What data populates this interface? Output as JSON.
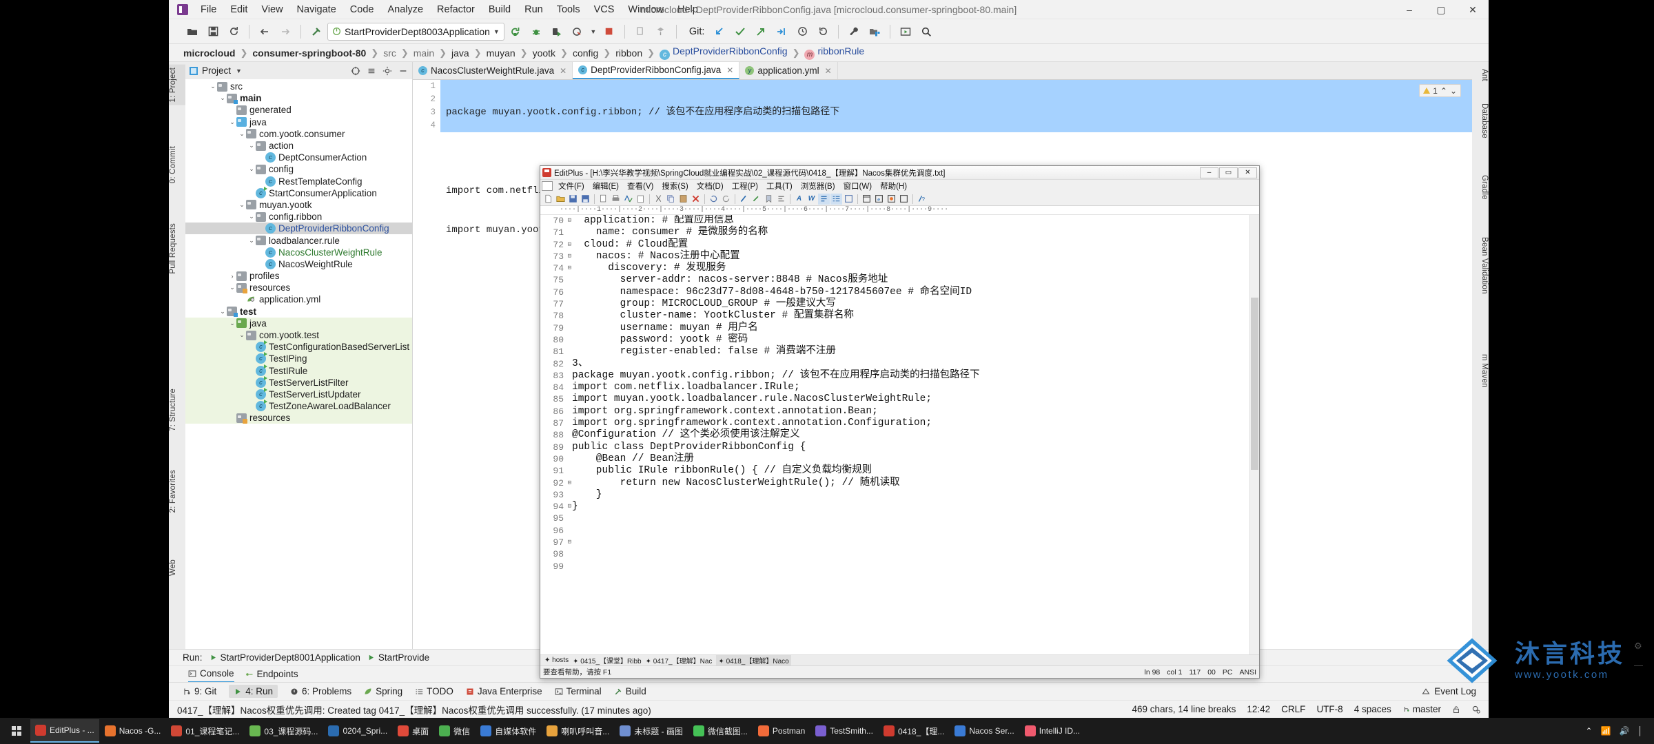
{
  "window": {
    "title": "microcloud - DeptProviderRibbonConfig.java [microcloud.consumer-springboot-80.main]",
    "minimize": "–",
    "maximize": "▢",
    "close": "✕"
  },
  "menubar": {
    "items": [
      "File",
      "Edit",
      "View",
      "Navigate",
      "Code",
      "Analyze",
      "Refactor",
      "Build",
      "Run",
      "Tools",
      "VCS",
      "Window",
      "Help"
    ]
  },
  "toolbar": {
    "run_config": "StartProviderDept8003Application",
    "git_label": "Git:",
    "icons": [
      "open-folder-icon",
      "save-icon",
      "sync-icon",
      "back-arrow-icon",
      "forward-arrow-icon",
      "build-hammer-icon",
      "run-icon",
      "debug-icon",
      "run-with-coverage-icon",
      "profile-icon",
      "stop-icon",
      "device-manager-icon",
      "sdk-manager-icon",
      "git-pull-icon",
      "git-commit-check-icon",
      "git-push-icon",
      "git-update-icon",
      "history-icon",
      "rollback-icon",
      "wrench-icon",
      "project-structure-icon",
      "presentation-icon",
      "search-everywhere-icon"
    ]
  },
  "breadcrumb": {
    "items": [
      {
        "label": "microcloud",
        "style": "bold"
      },
      {
        "label": "consumer-springboot-80",
        "style": "bold"
      },
      {
        "label": "src",
        "style": "dim"
      },
      {
        "label": "main",
        "style": "dim"
      },
      {
        "label": "java",
        "style": "normal"
      },
      {
        "label": "muyan",
        "style": "normal"
      },
      {
        "label": "yootk",
        "style": "normal"
      },
      {
        "label": "config",
        "style": "normal"
      },
      {
        "label": "ribbon",
        "style": "normal"
      },
      {
        "label": "DeptProviderRibbonConfig",
        "style": "class"
      },
      {
        "label": "ribbonRule",
        "style": "method"
      }
    ]
  },
  "left_rail": [
    {
      "label": "1: Project",
      "selected": true
    },
    {
      "label": "0: Commit",
      "selected": false
    },
    {
      "label": "Pull Requests",
      "selected": false
    },
    {
      "label": "7: Structure",
      "selected": false
    },
    {
      "label": "2: Favorites",
      "selected": false
    },
    {
      "label": "Web",
      "selected": false
    }
  ],
  "right_rail": [
    {
      "label": "Ant"
    },
    {
      "label": "Database"
    },
    {
      "label": "Gradle"
    },
    {
      "label": "Bean Validation"
    },
    {
      "label": "m Maven"
    }
  ],
  "project_panel": {
    "title": "Project",
    "tree": [
      {
        "indent": 2,
        "arrow": "v",
        "icon": "folder-gray",
        "label": "src",
        "style": "normal"
      },
      {
        "indent": 3,
        "arrow": "v",
        "icon": "folder-gray-src",
        "label": "main",
        "style": "bold"
      },
      {
        "indent": 4,
        "arrow": "",
        "icon": "folder-generated",
        "label": "generated",
        "style": "normal"
      },
      {
        "indent": 4,
        "arrow": "v",
        "icon": "folder-blue",
        "label": "java",
        "style": "normal"
      },
      {
        "indent": 5,
        "arrow": "v",
        "icon": "folder-pkg",
        "label": "com.yootk.consumer",
        "style": "normal"
      },
      {
        "indent": 6,
        "arrow": "v",
        "icon": "folder-pkg",
        "label": "action",
        "style": "normal"
      },
      {
        "indent": 7,
        "arrow": "",
        "icon": "class",
        "label": "DeptConsumerAction",
        "style": "normal"
      },
      {
        "indent": 6,
        "arrow": "v",
        "icon": "folder-pkg",
        "label": "config",
        "style": "normal"
      },
      {
        "indent": 7,
        "arrow": "",
        "icon": "class",
        "label": "RestTemplateConfig",
        "style": "normal"
      },
      {
        "indent": 6,
        "arrow": "",
        "icon": "class-run",
        "label": "StartConsumerApplication",
        "style": "normal"
      },
      {
        "indent": 5,
        "arrow": "v",
        "icon": "folder-pkg",
        "label": "muyan.yootk",
        "style": "normal"
      },
      {
        "indent": 6,
        "arrow": "v",
        "icon": "folder-pkg",
        "label": "config.ribbon",
        "style": "normal"
      },
      {
        "indent": 7,
        "arrow": "",
        "icon": "class",
        "label": "DeptProviderRibbonConfig",
        "style": "blue",
        "selected": true
      },
      {
        "indent": 6,
        "arrow": "v",
        "icon": "folder-pkg",
        "label": "loadbalancer.rule",
        "style": "normal"
      },
      {
        "indent": 7,
        "arrow": "",
        "icon": "class",
        "label": "NacosClusterWeightRule",
        "style": "green"
      },
      {
        "indent": 7,
        "arrow": "",
        "icon": "class",
        "label": "NacosWeightRule",
        "style": "normal"
      },
      {
        "indent": 4,
        "arrow": ">",
        "icon": "folder-gray",
        "label": "profiles",
        "style": "normal"
      },
      {
        "indent": 4,
        "arrow": "v",
        "icon": "folder-res",
        "label": "resources",
        "style": "normal"
      },
      {
        "indent": 5,
        "arrow": "",
        "icon": "yml",
        "label": "application.yml",
        "style": "normal"
      },
      {
        "indent": 3,
        "arrow": "v",
        "icon": "folder-gray-test",
        "label": "test",
        "style": "bold"
      },
      {
        "indent": 4,
        "arrow": "v",
        "icon": "folder-green",
        "label": "java",
        "style": "normal",
        "green": true
      },
      {
        "indent": 5,
        "arrow": "v",
        "icon": "folder-pkg",
        "label": "com.yootk.test",
        "style": "normal",
        "green": true
      },
      {
        "indent": 6,
        "arrow": "",
        "icon": "class-run",
        "label": "TestConfigurationBasedServerList",
        "style": "normal",
        "green": true
      },
      {
        "indent": 6,
        "arrow": "",
        "icon": "class-run",
        "label": "TestIPing",
        "style": "normal",
        "green": true
      },
      {
        "indent": 6,
        "arrow": "",
        "icon": "class-run",
        "label": "TestIRule",
        "style": "normal",
        "green": true
      },
      {
        "indent": 6,
        "arrow": "",
        "icon": "class-run",
        "label": "TestServerListFilter",
        "style": "normal",
        "green": true
      },
      {
        "indent": 6,
        "arrow": "",
        "icon": "class-run",
        "label": "TestServerListUpdater",
        "style": "normal",
        "green": true
      },
      {
        "indent": 6,
        "arrow": "",
        "icon": "class-run",
        "label": "TestZoneAwareLoadBalancer",
        "style": "normal",
        "green": true
      },
      {
        "indent": 4,
        "arrow": "",
        "icon": "folder-res",
        "label": "resources",
        "style": "normal",
        "green": true
      }
    ]
  },
  "editor": {
    "tabs": [
      {
        "label": "NacosClusterWeightRule.java",
        "active": false,
        "closable": true
      },
      {
        "label": "DeptProviderRibbonConfig.java",
        "active": true,
        "closable": true
      },
      {
        "label": "application.yml",
        "active": false,
        "closable": true
      }
    ],
    "warning_count": "1",
    "lines": [
      {
        "no": "1",
        "text": "package muyan.yootk.config.ribbon; // 该包不在应用程序启动类的扫描包路径下"
      },
      {
        "no": "2",
        "text": ""
      },
      {
        "no": "3",
        "text": "import com.netflix.loadbalancer.IRule;"
      },
      {
        "no": "4",
        "text": "import muyan.yootk.loadbalancer.rule.NacosClusterWeightRule;"
      }
    ]
  },
  "editplus": {
    "title": "EditPlus - [H:\\李兴华教学视频\\SpringCloud就业编程实战\\02_课程源代码\\0418_【理解】Nacos集群优先调度.txt]",
    "menus": [
      "文件(F)",
      "编辑(E)",
      "查看(V)",
      "搜索(S)",
      "文档(D)",
      "工程(P)",
      "工具(T)",
      "浏览器(B)",
      "窗口(W)",
      "帮助(H)"
    ],
    "ruler": "····|····1····|····2····|····3····|····4····|····5····|····6····|····7····|····8····|····9····",
    "lines": [
      {
        "no": "70",
        "fold": true,
        "text": "  application: # 配置应用信息"
      },
      {
        "no": "71",
        "fold": false,
        "text": "    name: consumer # 是微服务的名称"
      },
      {
        "no": "72",
        "fold": true,
        "text": "  cloud: # Cloud配置"
      },
      {
        "no": "73",
        "fold": true,
        "text": "    nacos: # Nacos注册中心配置"
      },
      {
        "no": "74",
        "fold": true,
        "text": "      discovery: # 发现服务"
      },
      {
        "no": "75",
        "fold": false,
        "text": "        server-addr: nacos-server:8848 # Nacos服务地址"
      },
      {
        "no": "76",
        "fold": false,
        "text": "        namespace: 96c23d77-8d08-4648-b750-1217845607ee # 命名空间ID"
      },
      {
        "no": "77",
        "fold": false,
        "text": "        group: MICROCLOUD_GROUP # 一般建议大写"
      },
      {
        "no": "78",
        "fold": false,
        "text": "        cluster-name: YootkCluster # 配置集群名称"
      },
      {
        "no": "79",
        "fold": false,
        "text": "        username: muyan # 用户名"
      },
      {
        "no": "80",
        "fold": false,
        "text": "        password: yootk # 密码"
      },
      {
        "no": "81",
        "fold": false,
        "text": "        register-enabled: false # 消费端不注册"
      },
      {
        "no": "82",
        "fold": false,
        "text": ""
      },
      {
        "no": "83",
        "fold": false,
        "text": "3、"
      },
      {
        "no": "84",
        "fold": false,
        "text": "package muyan.yootk.config.ribbon; // 该包不在应用程序启动类的扫描包路径下"
      },
      {
        "no": "85",
        "fold": false,
        "text": ""
      },
      {
        "no": "86",
        "fold": false,
        "text": "import com.netflix.loadbalancer.IRule;"
      },
      {
        "no": "87",
        "fold": false,
        "text": "import muyan.yootk.loadbalancer.rule.NacosClusterWeightRule;"
      },
      {
        "no": "88",
        "fold": false,
        "text": "import org.springframework.context.annotation.Bean;"
      },
      {
        "no": "89",
        "fold": false,
        "text": "import org.springframework.context.annotation.Configuration;"
      },
      {
        "no": "90",
        "fold": false,
        "text": ""
      },
      {
        "no": "91",
        "fold": false,
        "text": "@Configuration // 这个类必须使用该注解定义"
      },
      {
        "no": "92",
        "fold": true,
        "text": "public class DeptProviderRibbonConfig {"
      },
      {
        "no": "93",
        "fold": false,
        "text": "    @Bean // Bean注册"
      },
      {
        "no": "94",
        "fold": true,
        "text": "    public IRule ribbonRule() { // 自定义负载均衡规则"
      },
      {
        "no": "95",
        "fold": false,
        "text": "        return new NacosClusterWeightRule(); // 随机读取"
      },
      {
        "no": "96",
        "fold": false,
        "text": "    }"
      },
      {
        "no": "97",
        "fold": true,
        "text": "}"
      },
      {
        "no": "98",
        "fold": false,
        "text": ""
      },
      {
        "no": "99",
        "fold": false,
        "text": ""
      }
    ],
    "status": {
      "ln": "98",
      "col": "1",
      "ch": "117",
      "sel": "00",
      "mode": "PC",
      "enc": "ANSI",
      "hint": "要查看帮助，请按 F1"
    },
    "doc_tabs": [
      "hosts",
      "0415_【课堂】Ribb",
      "0417_【理解】Nac",
      "0418_【理解】Naco"
    ]
  },
  "watermark": {
    "cn": "沐言科技",
    "en": "www.yootk.com"
  },
  "run_panel": {
    "label": "Run:",
    "config1": "StartProviderDept8001Application",
    "config2": "StartProvide",
    "tabs": [
      {
        "label": "Console",
        "active": true
      },
      {
        "label": "Endpoints",
        "active": false
      }
    ]
  },
  "statusbar": {
    "items": [
      {
        "label": "9: Git",
        "icon": "git-icon",
        "active": false
      },
      {
        "label": "4: Run",
        "icon": "run-icon",
        "active": true
      },
      {
        "label": "6: Problems",
        "icon": "problems-icon",
        "active": false
      },
      {
        "label": "Spring",
        "icon": "spring-leaf-icon",
        "active": false
      },
      {
        "label": "TODO",
        "icon": "todo-icon",
        "active": false
      },
      {
        "label": "Java Enterprise",
        "icon": "java-ee-icon",
        "active": false
      },
      {
        "label": "Terminal",
        "icon": "terminal-icon",
        "active": false
      },
      {
        "label": "Build",
        "icon": "build-hammer-icon",
        "active": false
      }
    ],
    "event_log": "Event Log"
  },
  "messagebar": {
    "text": "0417_【理解】Nacos权重优先调用: Created tag 0417_【理解】Nacos权重优先调用 successfully. (17 minutes ago)",
    "chars": "469 chars, 14 line breaks",
    "time": "12:42",
    "line_sep": "CRLF",
    "encoding": "UTF-8",
    "indent": "4 spaces",
    "branch": "master"
  },
  "taskbar": {
    "items": [
      {
        "label": "EditPlus - ...",
        "color": "#cf3b2f",
        "active": true
      },
      {
        "label": "Nacos -G...",
        "color": "#e8732e",
        "active": false
      },
      {
        "label": "01_课程笔记...",
        "color": "#d14836",
        "active": false
      },
      {
        "label": "03_课程源码...",
        "color": "#69b851",
        "active": false
      },
      {
        "label": "0204_Spri...",
        "color": "#2b6cb0",
        "active": false
      },
      {
        "label": "桌面",
        "color": "#e04a3a",
        "active": false
      },
      {
        "label": "微信",
        "color": "#4caf50",
        "active": false
      },
      {
        "label": "自媒体软件",
        "color": "#3a7bd5",
        "active": false
      },
      {
        "label": "喇叭呼叫音...",
        "color": "#e8a33d",
        "active": false
      },
      {
        "label": "未标题 - 画图",
        "color": "#6f8fd0",
        "active": false
      },
      {
        "label": "微信截图...",
        "color": "#45c156",
        "active": false
      },
      {
        "label": "Postman",
        "color": "#f26b3a",
        "active": false
      },
      {
        "label": "TestSmith...",
        "color": "#7a5fd0",
        "active": false
      },
      {
        "label": "0418_【理...",
        "color": "#cf3b2f",
        "active": false
      },
      {
        "label": "Nacos Ser...",
        "color": "#3a7bd5",
        "active": false
      },
      {
        "label": "IntelliJ ID...",
        "color": "#f05a6e",
        "active": false
      }
    ]
  }
}
